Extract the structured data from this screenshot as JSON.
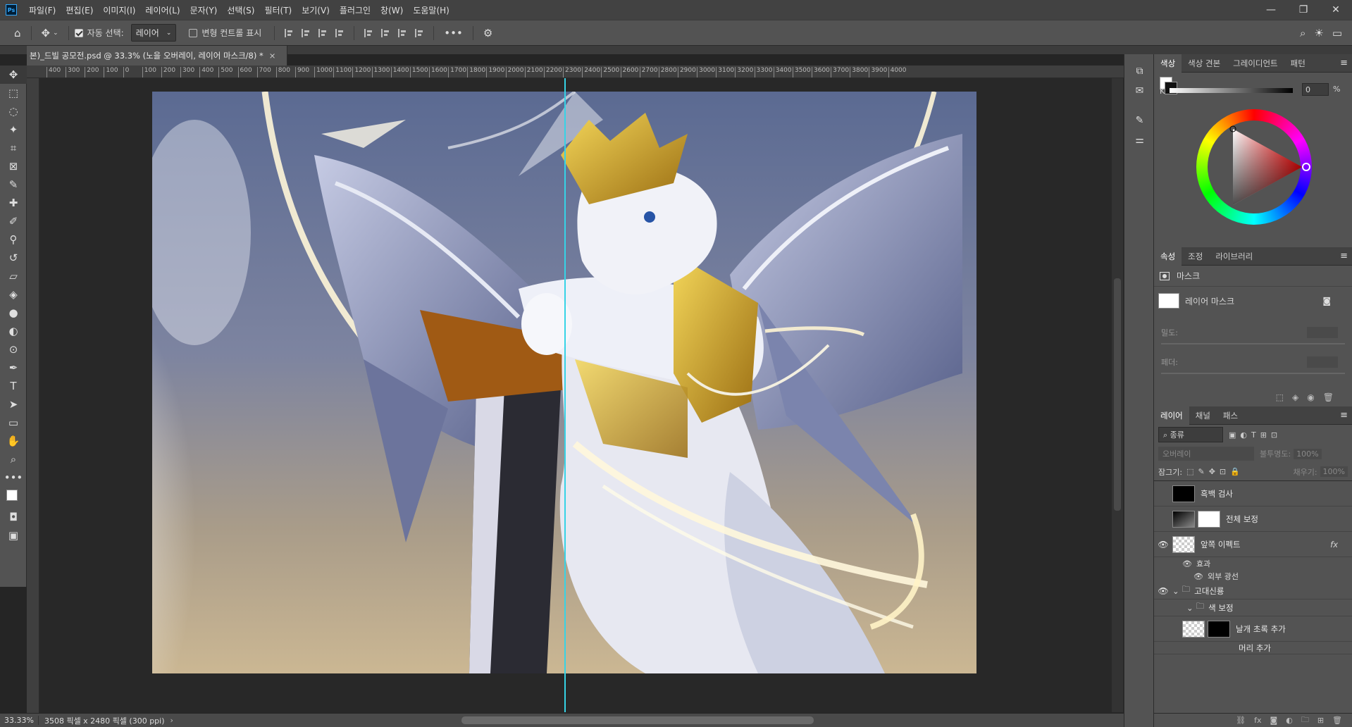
{
  "menu": [
    "파일(F)",
    "편집(E)",
    "이미지(I)",
    "레이어(L)",
    "문자(Y)",
    "선택(S)",
    "필터(T)",
    "보기(V)",
    "플러그인",
    "창(W)",
    "도움말(H)"
  ],
  "window_controls": {
    "minimize": "—",
    "restore": "❐",
    "close": "✕"
  },
  "options": {
    "auto_select_label": "자동 선택:",
    "auto_select_value": "레이어",
    "transform_label": "변형 컨트롤 표시",
    "more": "•••"
  },
  "document": {
    "tab_title": "본)_드빌 공모전.psd @ 33.3% (노을 오버레이, 레이어 마스크/8) *",
    "close": "×",
    "ruler_ticks": [
      "400",
      "300",
      "200",
      "100",
      "0",
      "100",
      "200",
      "300",
      "400",
      "500",
      "600",
      "700",
      "800",
      "900",
      "1000",
      "1100",
      "1200",
      "1300",
      "1400",
      "1500",
      "1600",
      "1700",
      "1800",
      "1900",
      "2000",
      "2100",
      "2200",
      "2300",
      "2400",
      "2500",
      "2600",
      "2700",
      "2800",
      "2900",
      "3000",
      "3100",
      "3200",
      "3300",
      "3400",
      "3500",
      "3600",
      "3700",
      "3800",
      "3900",
      "4000"
    ]
  },
  "status": {
    "zoom": "33.33%",
    "info": "3508 픽셀 x 2480 픽셀 (300 ppi)"
  },
  "color_panel": {
    "tabs": [
      "색상",
      "색상 견본",
      "그레이디언트",
      "패턴"
    ],
    "k_label": "K",
    "k_value": "0",
    "percent": "%"
  },
  "properties_panel": {
    "tabs": [
      "속성",
      "조정",
      "라이브러리"
    ],
    "mask_header": "마스크",
    "layer_mask": "레이어 마스크",
    "density_label": "밀도:",
    "feather_label": "페더:"
  },
  "layers_panel": {
    "tabs": [
      "레이어",
      "채널",
      "패스"
    ],
    "filter_kind": "종류",
    "blend_mode": "오버레이",
    "opacity_label": "불투명도:",
    "opacity_value": "100%",
    "lock_label": "잠그기:",
    "fill_label": "채우기:",
    "fill_value": "100%",
    "layers": [
      {
        "name": "흑백 검사",
        "visible": false
      },
      {
        "name": "전체 보정",
        "visible": false
      },
      {
        "name": "앞쪽 이펙트",
        "visible": true,
        "fx": "fx"
      },
      {
        "name": "효과",
        "visible": true
      },
      {
        "name": "외부 광선",
        "visible": true
      },
      {
        "name": "고대신룡",
        "visible": true
      },
      {
        "name": "색 보정",
        "visible": false
      },
      {
        "name": "날개 초록 추가",
        "visible": false
      },
      {
        "name": "머리 추가",
        "visible": false
      }
    ]
  },
  "colors": {
    "accent": "#31a8ff",
    "guide": "#36d3e6",
    "ui_dark": "#535353"
  }
}
